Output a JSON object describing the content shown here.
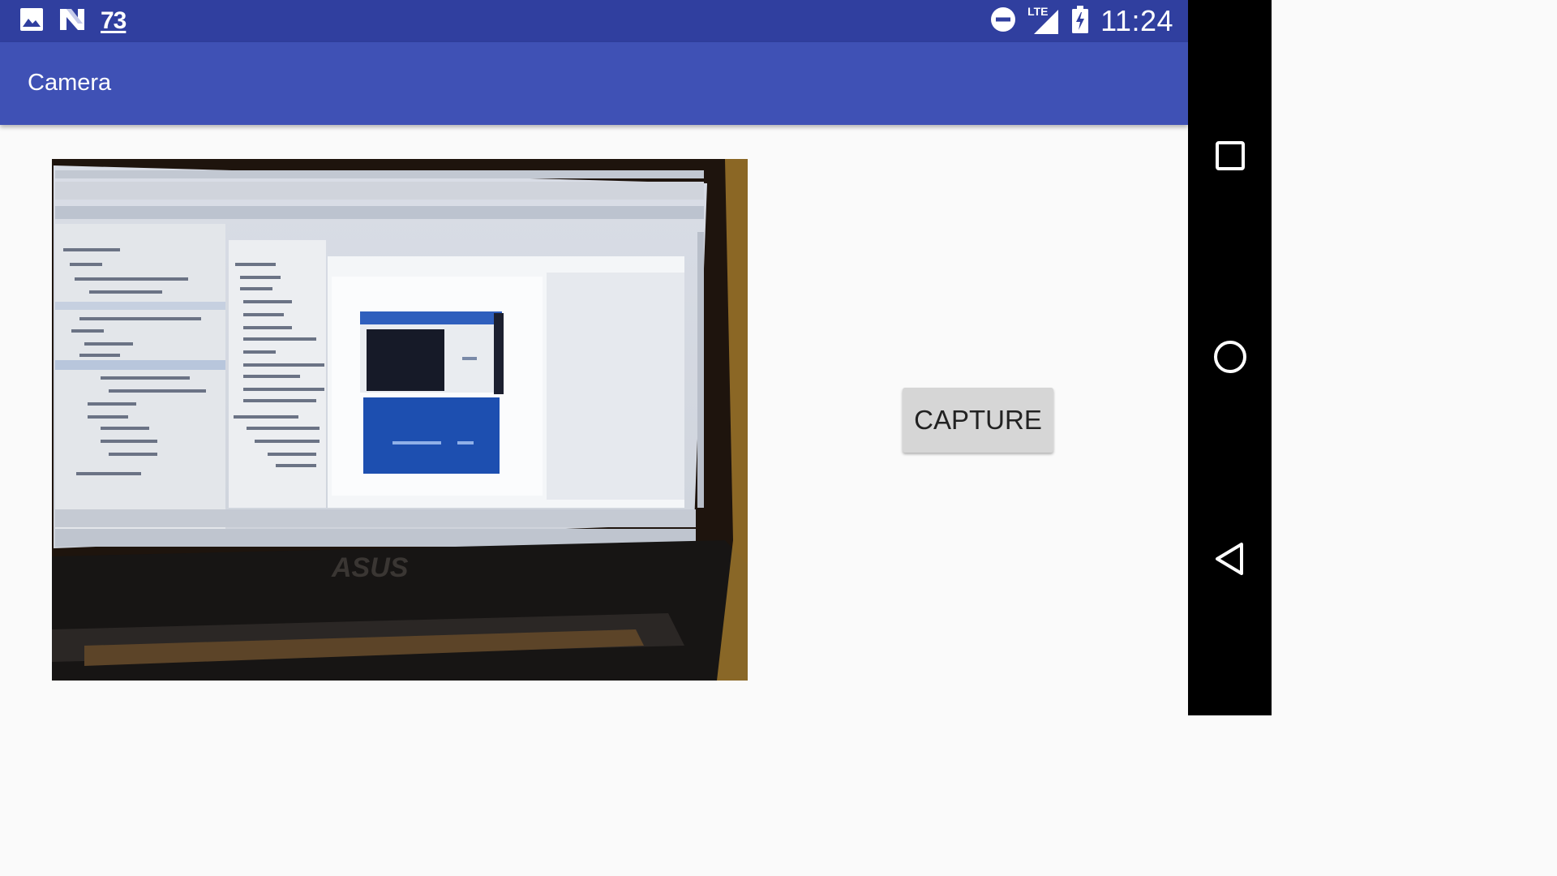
{
  "status_bar": {
    "left_icons": [
      "image-icon",
      "n-logo-icon"
    ],
    "notification_count": "73",
    "network_label": "LTE",
    "time": "11:24",
    "right_icons": [
      "do-not-disturb-icon",
      "signal-icon",
      "battery-charging-icon"
    ]
  },
  "app_bar": {
    "title": "Camera"
  },
  "camera_preview": {
    "content": "camera-preview-image"
  },
  "capture_button": {
    "label": "CAPTURE"
  },
  "nav_bar": {
    "buttons": [
      "recents-icon",
      "home-icon",
      "back-icon"
    ]
  },
  "colors": {
    "status_bar": "#303f9f",
    "app_bar": "#3f51b5",
    "background": "#fafafa",
    "button": "#d6d6d6",
    "nav_bar": "#000000"
  }
}
